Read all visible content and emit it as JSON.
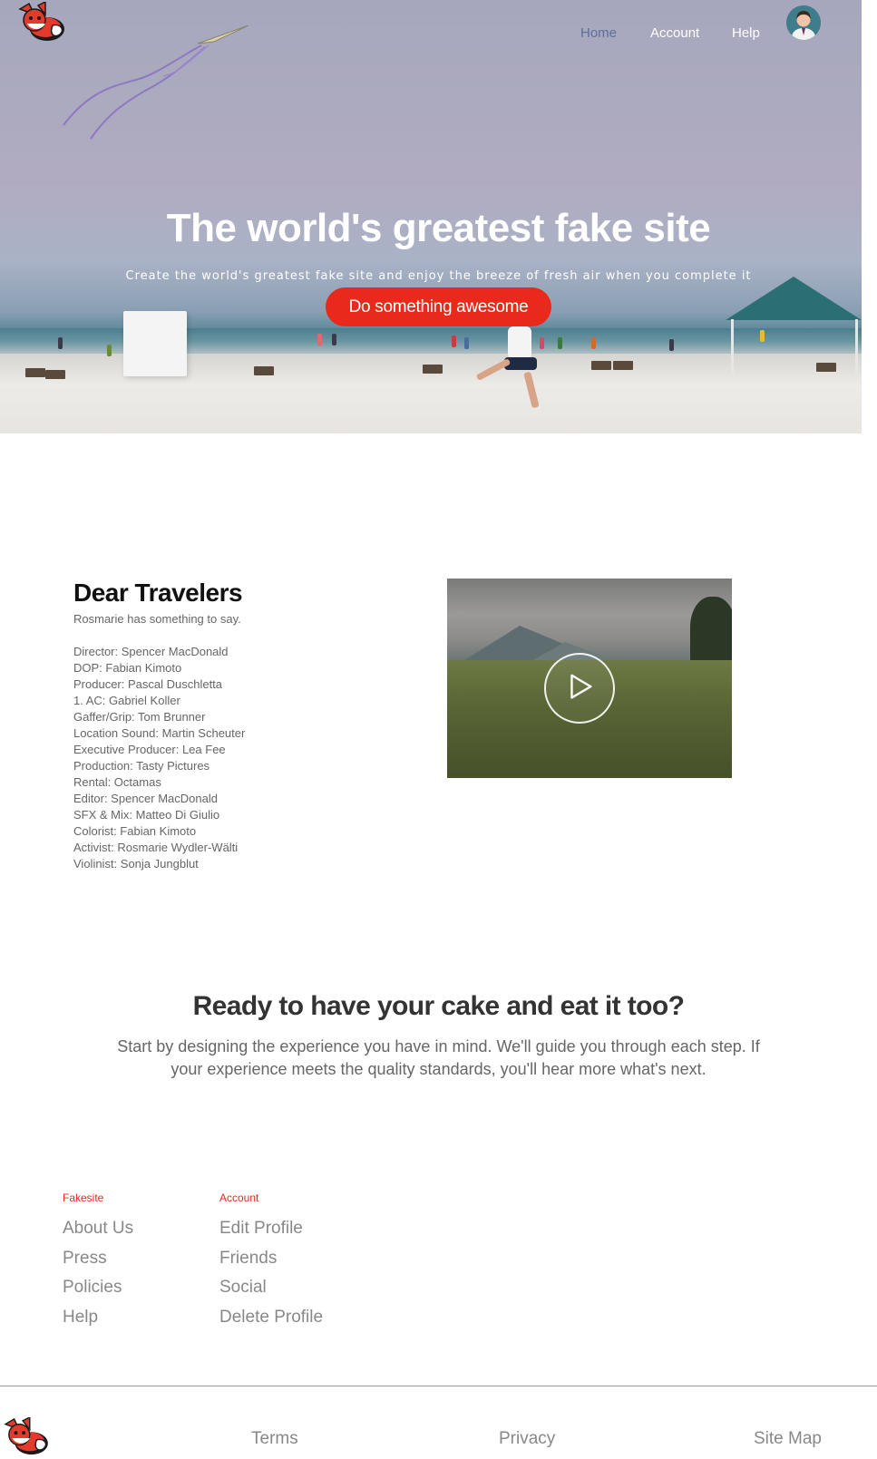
{
  "nav": {
    "items": [
      {
        "label": "Home",
        "active": true
      },
      {
        "label": "Account",
        "active": false
      },
      {
        "label": "Help",
        "active": false
      }
    ]
  },
  "hero": {
    "title": "The world's greatest fake site",
    "subtitle": "Create the world's greatest fake site and enjoy the breeze of fresh air when you complete it",
    "cta_label": "Do something awesome"
  },
  "credits": {
    "title": "Dear Travelers",
    "subtitle": "Rosmarie has something to say.",
    "lines": [
      "Director: Spencer MacDonald",
      "DOP: Fabian Kimoto",
      "Producer: Pascal Duschletta",
      "1. AC: Gabriel Koller",
      "Gaffer/Grip: Tom Brunner",
      "Location Sound: Martin Scheuter",
      "Executive Producer: Lea Fee",
      "Production: Tasty Pictures",
      "Rental: Octamas",
      "Editor: Spencer MacDonald",
      "SFX & Mix: Matteo Di Giulio",
      "Colorist: Fabian Kimoto",
      "Activist: Rosmarie Wydler-Wälti",
      "Violinist: Sonja Jungblut"
    ]
  },
  "cta": {
    "title": "Ready to have your cake and eat it too?",
    "text": "Start by designing the experience you have in mind. We'll guide you through each step. If your experience meets the quality standards, you'll hear more what's next."
  },
  "footer": {
    "columns": [
      {
        "heading": "Fakesite",
        "links": [
          "About Us",
          "Press",
          "Policies",
          "Help"
        ]
      },
      {
        "heading": "Account",
        "links": [
          "Edit Profile",
          "Friends",
          "Social",
          "Delete Profile"
        ]
      }
    ],
    "bottom_links": [
      "Terms",
      "Privacy",
      "Site Map"
    ]
  },
  "colors": {
    "accent": "#e8291c",
    "nav_active": "#5c6f9b"
  },
  "icons": {
    "logo": "fox-logo-icon",
    "avatar": "user-avatar-icon",
    "play": "play-icon"
  }
}
